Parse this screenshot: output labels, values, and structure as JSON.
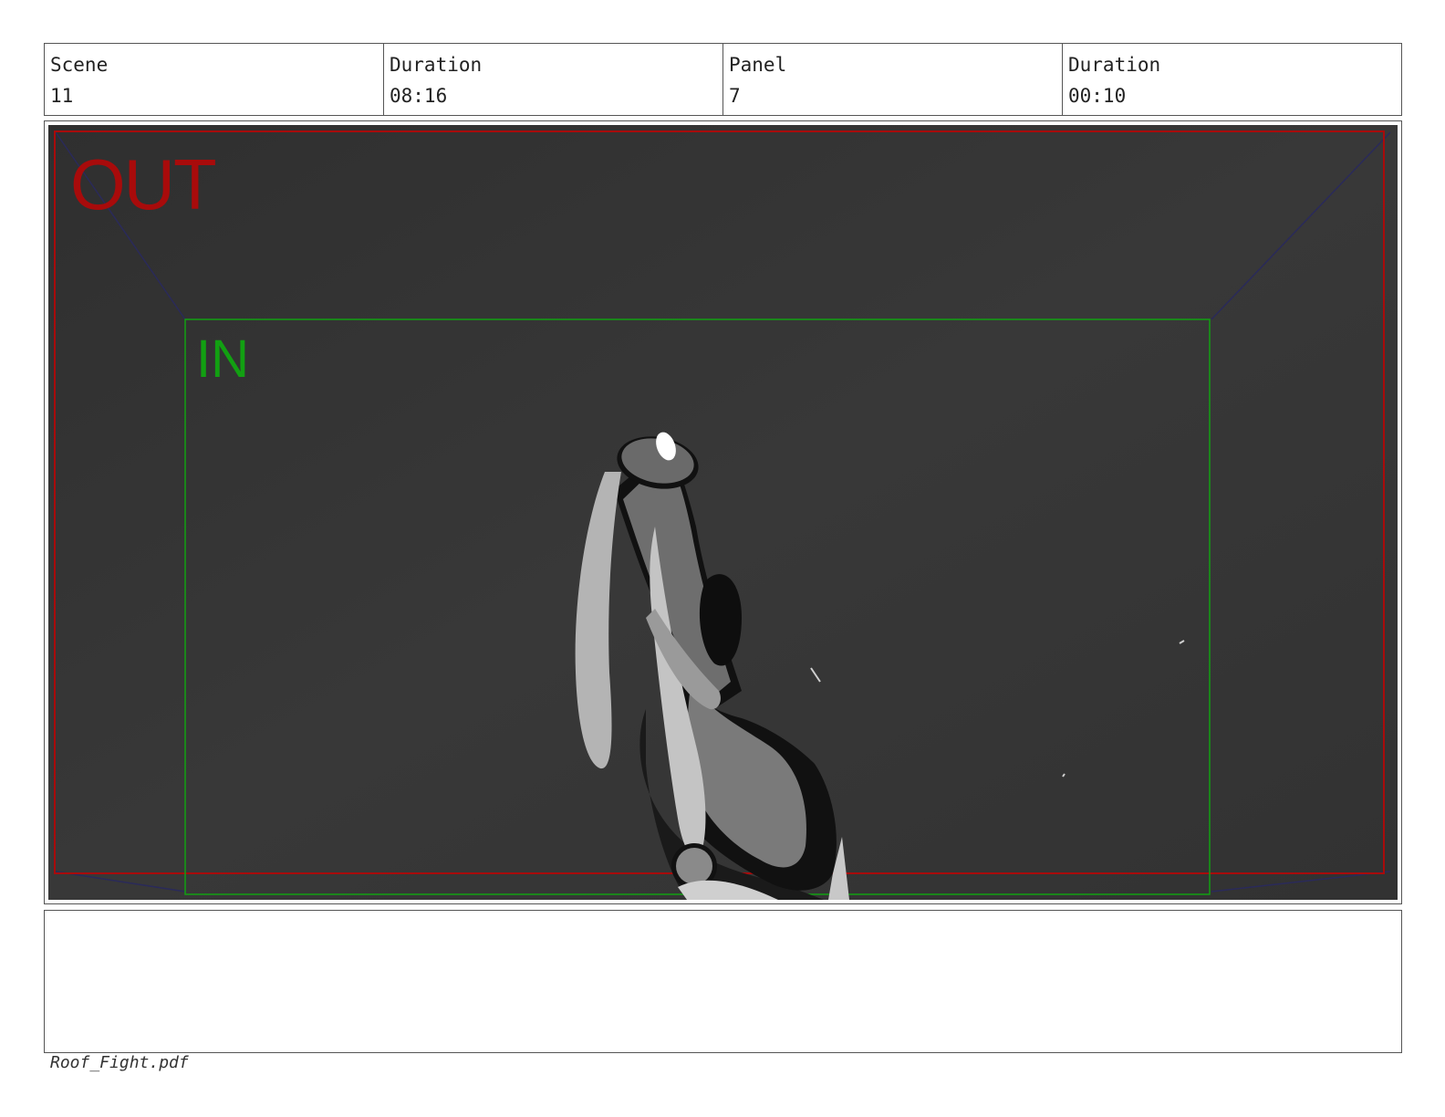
{
  "header": {
    "scene_label": "Scene",
    "scene_value": "11",
    "scene_duration_label": "Duration",
    "scene_duration_value": "08:16",
    "panel_label": "Panel",
    "panel_value": "7",
    "panel_duration_label": "Duration",
    "panel_duration_value": "00:10"
  },
  "panel": {
    "out_label": "OUT",
    "in_label": "IN"
  },
  "notes": {
    "text": ""
  },
  "footer": {
    "filename": "Roof_Fight.pdf"
  },
  "colors": {
    "background": "#353535",
    "out_frame": "#a80b0b",
    "in_frame": "#12a012",
    "guide_lines": "#2a2a5a"
  }
}
